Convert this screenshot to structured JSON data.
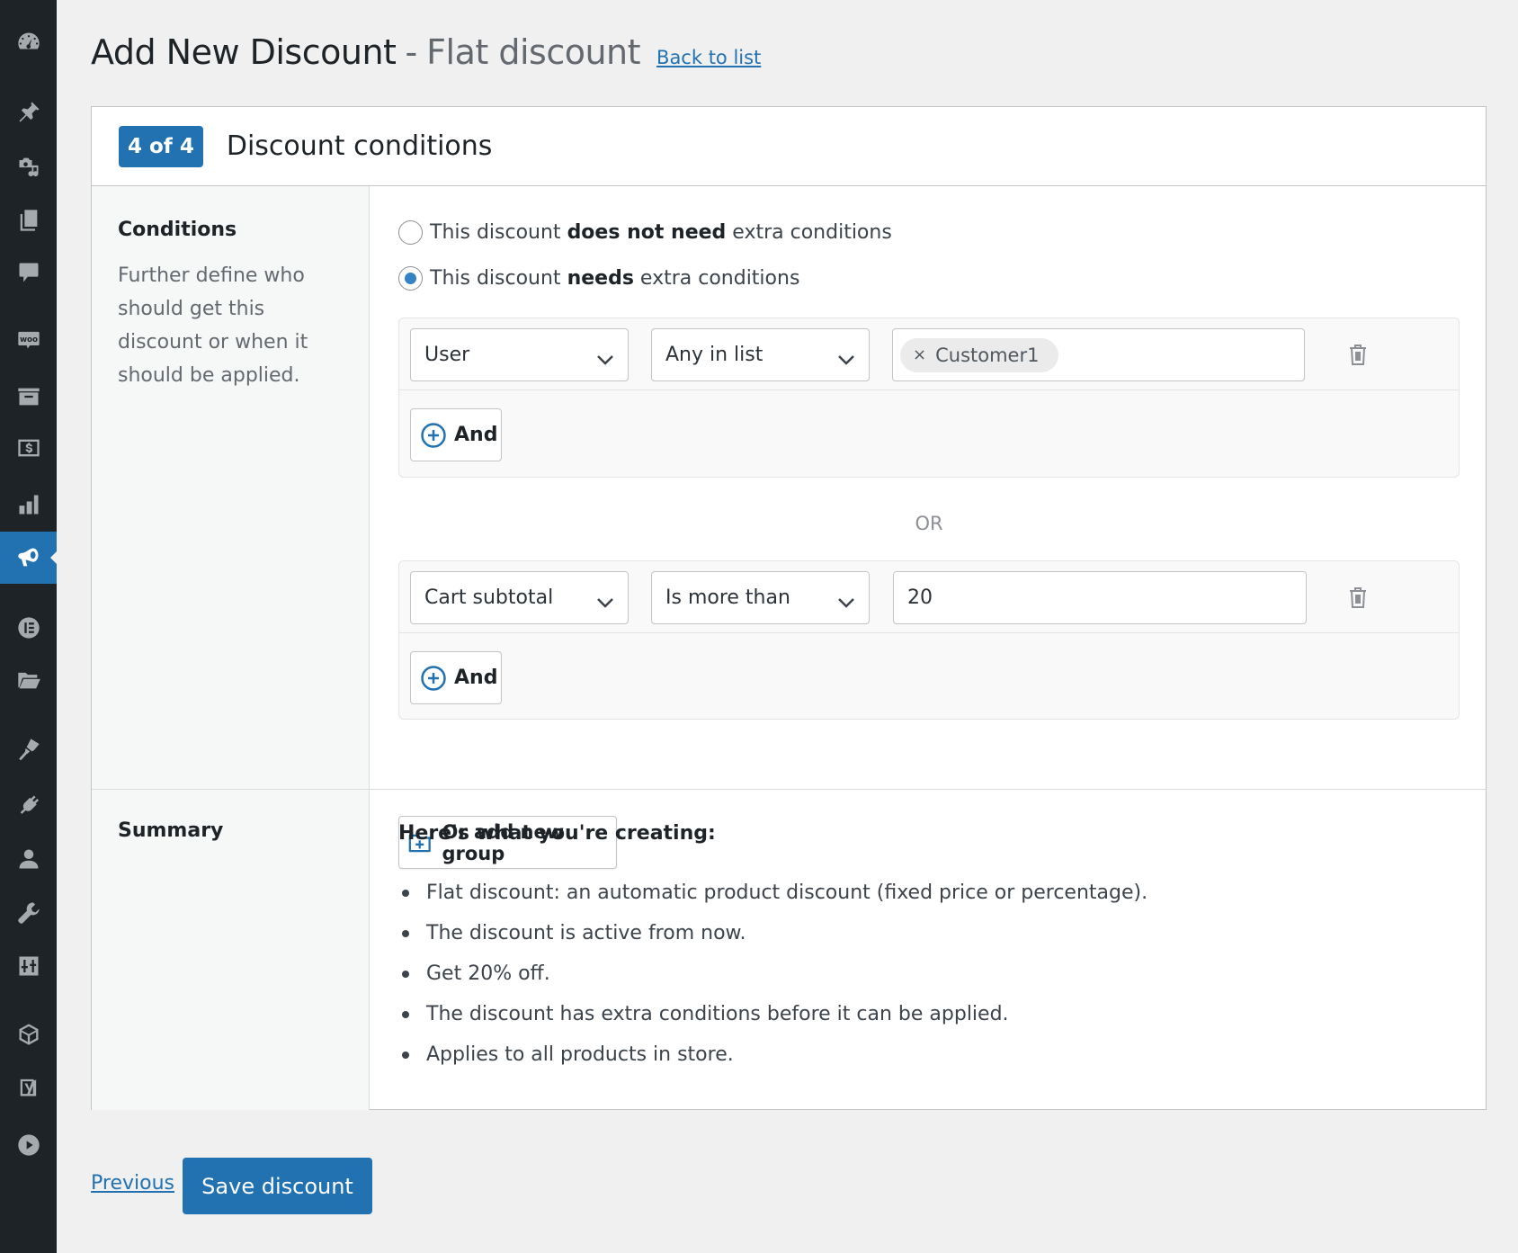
{
  "sidebar": {
    "items": [
      {
        "name": "dashboard",
        "icon": "dashboard-icon"
      },
      {
        "name": "posts",
        "icon": "pin-icon"
      },
      {
        "name": "media",
        "icon": "media-icon"
      },
      {
        "name": "pages",
        "icon": "pages-icon"
      },
      {
        "name": "comments",
        "icon": "comment-icon"
      },
      {
        "name": "woocommerce",
        "icon": "woo-icon",
        "label": "Woo"
      },
      {
        "name": "products",
        "icon": "archive-box-icon"
      },
      {
        "name": "payments",
        "icon": "dollar-icon"
      },
      {
        "name": "analytics",
        "icon": "bar-chart-icon"
      },
      {
        "name": "marketing",
        "icon": "megaphone-icon",
        "active": true
      },
      {
        "name": "elementor",
        "icon": "elementor-icon"
      },
      {
        "name": "templates",
        "icon": "folder-icon"
      },
      {
        "name": "appearance",
        "icon": "brush-icon"
      },
      {
        "name": "plugins",
        "icon": "plug-icon"
      },
      {
        "name": "users",
        "icon": "user-icon"
      },
      {
        "name": "tools",
        "icon": "wrench-icon"
      },
      {
        "name": "settings",
        "icon": "sliders-icon"
      },
      {
        "name": "blocks",
        "icon": "cube-icon"
      },
      {
        "name": "yoast-seo",
        "icon": "yoast-icon"
      },
      {
        "name": "media-player",
        "icon": "play-icon"
      }
    ]
  },
  "header": {
    "title": "Add New Discount",
    "separator": "-",
    "subtitle": "Flat discount",
    "back_link": "Back to list"
  },
  "card": {
    "step_badge": "4 of 4",
    "title": "Discount conditions"
  },
  "conditions": {
    "heading": "Conditions",
    "description": "Further define who should get this discount or when it should be applied.",
    "radio_options": [
      {
        "prefix": "This discount ",
        "bold": "does not need",
        "suffix": " extra conditions",
        "checked": false
      },
      {
        "prefix": "This discount ",
        "bold": "needs",
        "suffix": " extra conditions",
        "checked": true
      }
    ],
    "groups": [
      {
        "field": "User",
        "operator": "Any in list",
        "value_chips": [
          "Customer1"
        ],
        "and_label": "And"
      },
      {
        "field": "Cart subtotal",
        "operator": "Is more than",
        "value": "20",
        "and_label": "And"
      }
    ],
    "or_label": "OR",
    "add_group_label": "Or add new group"
  },
  "summary": {
    "heading": "Summary",
    "title": "Here's what you're creating:",
    "items": [
      "Flat discount: an automatic product discount (fixed price or percentage).",
      "The discount is active from now.",
      "Get 20% off.",
      "The discount has extra conditions before it can be applied.",
      "Applies to all products in store."
    ]
  },
  "footer": {
    "previous_label": "Previous",
    "save_label": "Save discount"
  },
  "colors": {
    "accent": "#2271b1",
    "sidebar_bg": "#1d2327",
    "page_bg": "#f0f0f1"
  }
}
